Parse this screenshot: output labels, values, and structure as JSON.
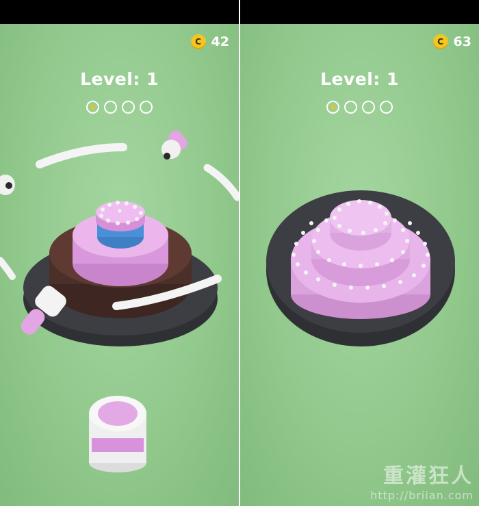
{
  "screens": [
    {
      "coins": "42",
      "coin_icon": "coin-icon",
      "level_text": "Level: 1",
      "progress": {
        "total": 4,
        "completed": 1
      }
    },
    {
      "coins": "63",
      "coin_icon": "coin-icon",
      "level_text": "Level: 1",
      "progress": {
        "total": 4,
        "completed": 1
      }
    }
  ],
  "coin_letter": "C",
  "watermark": {
    "title": "重灌狂人",
    "url": "http://briian.com"
  },
  "colors": {
    "background_green": "#92c98d",
    "coin_gold": "#f3c623",
    "cake_pink": "#e4a6e8",
    "chocolate": "#5e3a32",
    "plate_dark": "#3a3b3f",
    "blue_tier": "#4a8fd8"
  }
}
